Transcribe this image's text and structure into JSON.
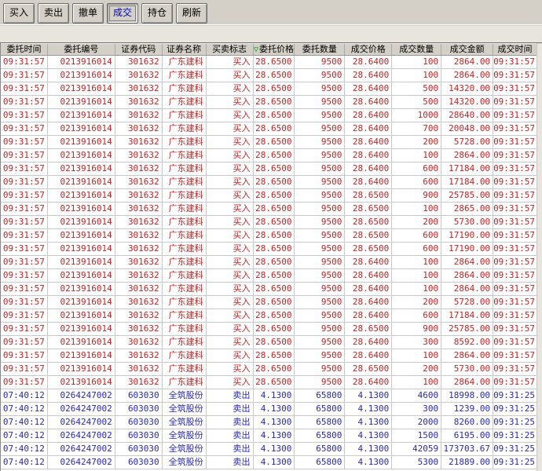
{
  "app": {
    "title": "成交查询 (executed trades panel)"
  },
  "colors": {
    "buy_text": "#c42424",
    "sell_text": "#2929b8",
    "active_button_text": "#0000c8",
    "sort_icon": "#00a400",
    "window_face": "#d4d0c8"
  },
  "toolbar": {
    "buttons": [
      {
        "id": "buy",
        "label": "买入",
        "active": false
      },
      {
        "id": "sell",
        "label": "卖出",
        "active": false
      },
      {
        "id": "cancel",
        "label": "撤单",
        "active": false
      },
      {
        "id": "deals",
        "label": "成交",
        "active": true
      },
      {
        "id": "positions",
        "label": "持仓",
        "active": false
      },
      {
        "id": "refresh",
        "label": "刷新",
        "active": false
      }
    ]
  },
  "table": {
    "columns": [
      {
        "id": "order-time",
        "label": "委托时间",
        "sort_icon": false
      },
      {
        "id": "order-no",
        "label": "委托编号",
        "sort_icon": false
      },
      {
        "id": "stock-code",
        "label": "证券代码",
        "sort_icon": false
      },
      {
        "id": "stock-name",
        "label": "证券名称",
        "sort_icon": false
      },
      {
        "id": "side-flag",
        "label": "买卖标志",
        "sort_icon": false
      },
      {
        "id": "order-price",
        "label": "委托价格",
        "sort_icon": true,
        "sort_glyph": "▽"
      },
      {
        "id": "order-qty",
        "label": "委托数量",
        "sort_icon": false
      },
      {
        "id": "exec-price",
        "label": "成交价格",
        "sort_icon": false
      },
      {
        "id": "exec-qty",
        "label": "成交数量",
        "sort_icon": false
      },
      {
        "id": "exec-amount",
        "label": "成交金额",
        "sort_icon": false
      },
      {
        "id": "exec-time",
        "label": "成交时间",
        "sort_icon": false
      }
    ],
    "rows": [
      {
        "color": "red",
        "cells": [
          "09:31:57",
          "0213916014",
          "301632",
          "广东建科",
          "买入",
          "28.6500",
          "9500",
          "28.6400",
          "100",
          "2864.00",
          "09:31:57"
        ]
      },
      {
        "color": "red",
        "cells": [
          "09:31:57",
          "0213916014",
          "301632",
          "广东建科",
          "买入",
          "28.6500",
          "9500",
          "28.6400",
          "100",
          "2864.00",
          "09:31:57"
        ]
      },
      {
        "color": "red",
        "cells": [
          "09:31:57",
          "0213916014",
          "301632",
          "广东建科",
          "买入",
          "28.6500",
          "9500",
          "28.6400",
          "500",
          "14320.00",
          "09:31:57"
        ]
      },
      {
        "color": "red",
        "cells": [
          "09:31:57",
          "0213916014",
          "301632",
          "广东建科",
          "买入",
          "28.6500",
          "9500",
          "28.6400",
          "500",
          "14320.00",
          "09:31:57"
        ]
      },
      {
        "color": "red",
        "cells": [
          "09:31:57",
          "0213916014",
          "301632",
          "广东建科",
          "买入",
          "28.6500",
          "9500",
          "28.6400",
          "1000",
          "28640.00",
          "09:31:57"
        ]
      },
      {
        "color": "red",
        "cells": [
          "09:31:57",
          "0213916014",
          "301632",
          "广东建科",
          "买入",
          "28.6500",
          "9500",
          "28.6400",
          "700",
          "20048.00",
          "09:31:57"
        ]
      },
      {
        "color": "red",
        "cells": [
          "09:31:57",
          "0213916014",
          "301632",
          "广东建科",
          "买入",
          "28.6500",
          "9500",
          "28.6400",
          "200",
          "5728.00",
          "09:31:57"
        ]
      },
      {
        "color": "red",
        "cells": [
          "09:31:57",
          "0213916014",
          "301632",
          "广东建科",
          "买入",
          "28.6500",
          "9500",
          "28.6400",
          "100",
          "2864.00",
          "09:31:57"
        ]
      },
      {
        "color": "red",
        "cells": [
          "09:31:57",
          "0213916014",
          "301632",
          "广东建科",
          "买入",
          "28.6500",
          "9500",
          "28.6400",
          "600",
          "17184.00",
          "09:31:57"
        ]
      },
      {
        "color": "red",
        "cells": [
          "09:31:57",
          "0213916014",
          "301632",
          "广东建科",
          "买入",
          "28.6500",
          "9500",
          "28.6400",
          "600",
          "17184.00",
          "09:31:57"
        ]
      },
      {
        "color": "red",
        "cells": [
          "09:31:57",
          "0213916014",
          "301632",
          "广东建科",
          "买入",
          "28.6500",
          "9500",
          "28.6500",
          "900",
          "25785.00",
          "09:31:57"
        ]
      },
      {
        "color": "red",
        "cells": [
          "09:31:57",
          "0213916014",
          "301632",
          "广东建科",
          "买入",
          "28.6500",
          "9500",
          "28.6500",
          "100",
          "2865.00",
          "09:31:57"
        ]
      },
      {
        "color": "red",
        "cells": [
          "09:31:57",
          "0213916014",
          "301632",
          "广东建科",
          "买入",
          "28.6500",
          "9500",
          "28.6500",
          "200",
          "5730.00",
          "09:31:57"
        ]
      },
      {
        "color": "red",
        "cells": [
          "09:31:57",
          "0213916014",
          "301632",
          "广东建科",
          "买入",
          "28.6500",
          "9500",
          "28.6500",
          "600",
          "17190.00",
          "09:31:57"
        ]
      },
      {
        "color": "red",
        "cells": [
          "09:31:57",
          "0213916014",
          "301632",
          "广东建科",
          "买入",
          "28.6500",
          "9500",
          "28.6500",
          "600",
          "17190.00",
          "09:31:57"
        ]
      },
      {
        "color": "red",
        "cells": [
          "09:31:57",
          "0213916014",
          "301632",
          "广东建科",
          "买入",
          "28.6500",
          "9500",
          "28.6400",
          "100",
          "2864.00",
          "09:31:57"
        ]
      },
      {
        "color": "red",
        "cells": [
          "09:31:57",
          "0213916014",
          "301632",
          "广东建科",
          "买入",
          "28.6500",
          "9500",
          "28.6400",
          "100",
          "2864.00",
          "09:31:57"
        ]
      },
      {
        "color": "red",
        "cells": [
          "09:31:57",
          "0213916014",
          "301632",
          "广东建科",
          "买入",
          "28.6500",
          "9500",
          "28.6400",
          "100",
          "2864.00",
          "09:31:57"
        ]
      },
      {
        "color": "red",
        "cells": [
          "09:31:57",
          "0213916014",
          "301632",
          "广东建科",
          "买入",
          "28.6500",
          "9500",
          "28.6400",
          "200",
          "5728.00",
          "09:31:57"
        ]
      },
      {
        "color": "red",
        "cells": [
          "09:31:57",
          "0213916014",
          "301632",
          "广东建科",
          "买入",
          "28.6500",
          "9500",
          "28.6400",
          "600",
          "17184.00",
          "09:31:57"
        ]
      },
      {
        "color": "red",
        "cells": [
          "09:31:57",
          "0213916014",
          "301632",
          "广东建科",
          "买入",
          "28.6500",
          "9500",
          "28.6500",
          "900",
          "25785.00",
          "09:31:57"
        ]
      },
      {
        "color": "red",
        "cells": [
          "09:31:57",
          "0213916014",
          "301632",
          "广东建科",
          "买入",
          "28.6500",
          "9500",
          "28.6400",
          "300",
          "8592.00",
          "09:31:57"
        ]
      },
      {
        "color": "red",
        "cells": [
          "09:31:57",
          "0213916014",
          "301632",
          "广东建科",
          "买入",
          "28.6500",
          "9500",
          "28.6400",
          "100",
          "2864.00",
          "09:31:57"
        ]
      },
      {
        "color": "red",
        "cells": [
          "09:31:57",
          "0213916014",
          "301632",
          "广东建科",
          "买入",
          "28.6500",
          "9500",
          "28.6500",
          "200",
          "5730.00",
          "09:31:57"
        ]
      },
      {
        "color": "red",
        "cells": [
          "09:31:57",
          "0213916014",
          "301632",
          "广东建科",
          "买入",
          "28.6500",
          "9500",
          "28.6400",
          "100",
          "2864.00",
          "09:31:57"
        ]
      },
      {
        "color": "blue",
        "cells": [
          "07:40:12",
          "0264247002",
          "603030",
          "全筑股份",
          "卖出",
          "4.1300",
          "65800",
          "4.1300",
          "4600",
          "18998.00",
          "09:31:25"
        ]
      },
      {
        "color": "blue",
        "cells": [
          "07:40:12",
          "0264247002",
          "603030",
          "全筑股份",
          "卖出",
          "4.1300",
          "65800",
          "4.1300",
          "300",
          "1239.00",
          "09:31:25"
        ]
      },
      {
        "color": "blue",
        "cells": [
          "07:40:12",
          "0264247002",
          "603030",
          "全筑股份",
          "卖出",
          "4.1300",
          "65800",
          "4.1300",
          "2000",
          "8260.00",
          "09:31:25"
        ]
      },
      {
        "color": "blue",
        "cells": [
          "07:40:12",
          "0264247002",
          "603030",
          "全筑股份",
          "卖出",
          "4.1300",
          "65800",
          "4.1300",
          "1500",
          "6195.00",
          "09:31:25"
        ]
      },
      {
        "color": "blue",
        "cells": [
          "07:40:12",
          "0264247002",
          "603030",
          "全筑股份",
          "卖出",
          "4.1300",
          "65800",
          "4.1300",
          "42059",
          "173703.67",
          "09:31:25"
        ]
      },
      {
        "color": "blue",
        "cells": [
          "07:40:12",
          "0264247002",
          "603030",
          "全筑股份",
          "卖出",
          "4.1300",
          "65800",
          "4.1300",
          "5300",
          "21889.00",
          "09:31:25"
        ]
      }
    ]
  }
}
